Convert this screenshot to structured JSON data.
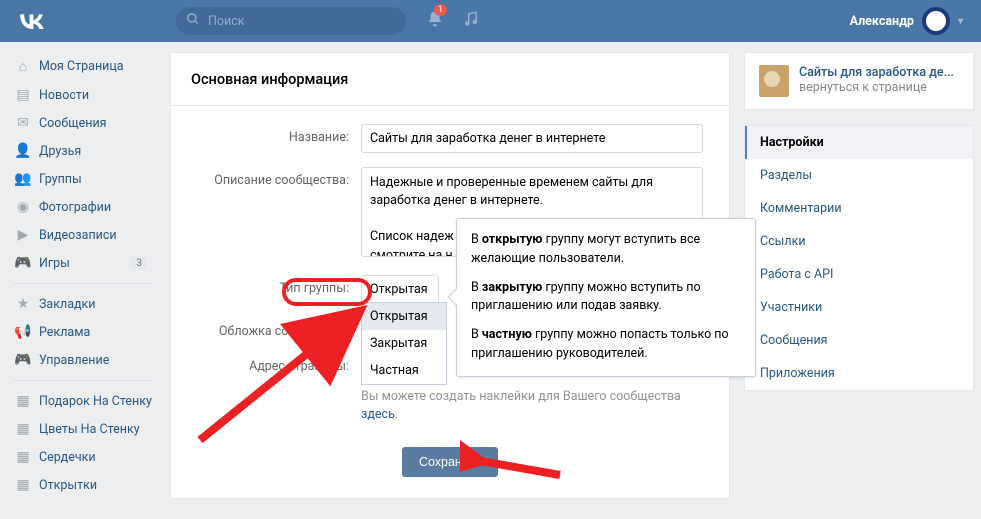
{
  "header": {
    "search_placeholder": "Поиск",
    "username": "Александр",
    "notif_count": "1"
  },
  "left_nav": {
    "items": [
      {
        "label": "Моя Страница"
      },
      {
        "label": "Новости"
      },
      {
        "label": "Сообщения"
      },
      {
        "label": "Друзья"
      },
      {
        "label": "Группы"
      },
      {
        "label": "Фотографии"
      },
      {
        "label": "Видеозаписи"
      },
      {
        "label": "Игры",
        "badge": "3"
      }
    ],
    "items2": [
      {
        "label": "Закладки"
      },
      {
        "label": "Реклама"
      },
      {
        "label": "Управление"
      }
    ],
    "items3": [
      {
        "label": "Подарок На Стенку"
      },
      {
        "label": "Цветы На Стенку"
      },
      {
        "label": "Сердечки"
      },
      {
        "label": "Открытки"
      }
    ]
  },
  "main": {
    "title": "Основная информация",
    "labels": {
      "name": "Название:",
      "desc": "Описание сообщества:",
      "type": "Тип группы:",
      "cover": "Обложка сообщества:",
      "addr": "Адрес страницы:"
    },
    "name_value": "Сайты для заработка денег в интернете",
    "desc_value": "Надежные и проверенные временем сайты для заработка денег в интернете.\n\nСписок надеж\nсмотрите на н",
    "type_selected": "Открытая",
    "type_options": [
      "Открытая",
      "Закрытая",
      "Частная"
    ],
    "stickers_hint": "Вы можете создать наклейки для Вашего сообщества ",
    "stickers_link": "здесь",
    "save_btn": "Сохранить"
  },
  "tooltip": {
    "p1a": "В ",
    "p1b": "открытую",
    "p1c": " группу могут вступить все желающие пользователи.",
    "p2a": "В ",
    "p2b": "закрытую",
    "p2c": " группу можно вступить по приглашению или подав заявку.",
    "p3a": "В ",
    "p3b": "частную",
    "p3c": " группу можно попасть только по приглашению руководителей."
  },
  "right": {
    "page_title": "Сайты для заработка де...",
    "page_sub": "вернуться к странице",
    "menu": [
      "Настройки",
      "Разделы",
      "Комментарии",
      "Ссылки",
      "Работа с API",
      "Участники",
      "Сообщения",
      "Приложения"
    ]
  }
}
